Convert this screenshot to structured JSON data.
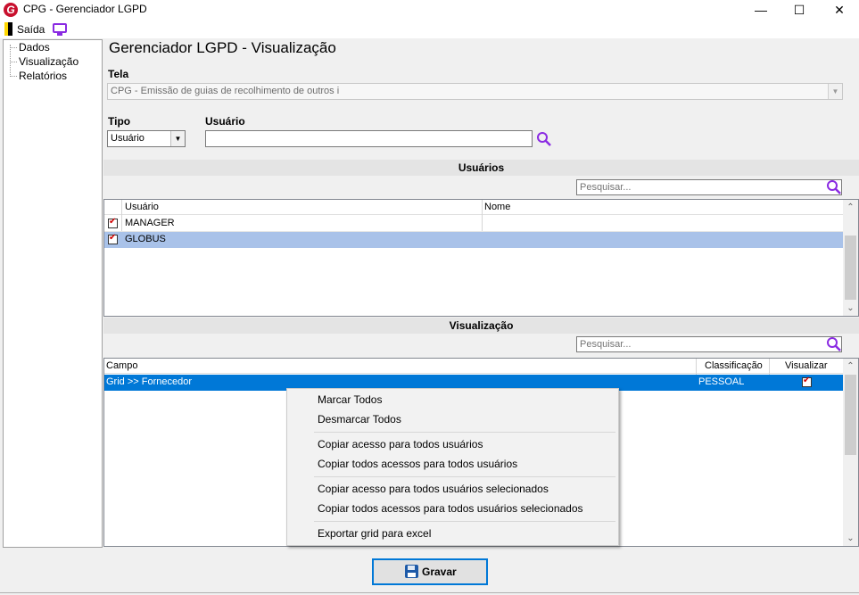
{
  "window": {
    "title": "CPG - Gerenciador LGPD",
    "logo_letter": "G",
    "minimize": "—",
    "maximize": "☐",
    "close": "✕"
  },
  "toolbar": {
    "exit_label": "Saída"
  },
  "tree": {
    "items": [
      "Dados",
      "Visualização",
      "Relatórios"
    ]
  },
  "page": {
    "title": "Gerenciador LGPD - Visualização",
    "tela_label": "Tela",
    "tela_value": "CPG - Emissão de guias de recolhimento de outros i",
    "tipo_label": "Tipo",
    "tipo_value": "Usuário",
    "usuario_label": "Usuário",
    "usuario_value": ""
  },
  "users_section": {
    "header": "Usuários",
    "search_placeholder": "Pesquisar...",
    "columns": [
      "Usuário",
      "Nome"
    ],
    "rows": [
      {
        "usuario": "MANAGER",
        "nome": "",
        "checked": true
      },
      {
        "usuario": "GLOBUS",
        "nome": "",
        "checked": true,
        "selected": true
      }
    ]
  },
  "view_section": {
    "header": "Visualização",
    "search_placeholder": "Pesquisar...",
    "columns": [
      "Campo",
      "Classificação",
      "Visualizar"
    ],
    "rows": [
      {
        "campo": "Grid >> Fornecedor",
        "classificacao": "PESSOAL",
        "visualizar": true
      }
    ]
  },
  "context_menu": {
    "items": [
      "Marcar Todos",
      "Desmarcar Todos",
      "Copiar acesso para todos usuários",
      "Copiar todos acessos para todos usuários",
      "Copiar acesso para todos usuários selecionados",
      "Copiar todos acessos para todos usuários selecionados",
      "Exportar grid para excel"
    ]
  },
  "footer": {
    "save_label": "Gravar"
  },
  "colors": {
    "selection_light": "#a9c2e9",
    "selection_blue": "#0078d7",
    "search_icon": "#8a2be2",
    "checkmark": "#d00000"
  }
}
